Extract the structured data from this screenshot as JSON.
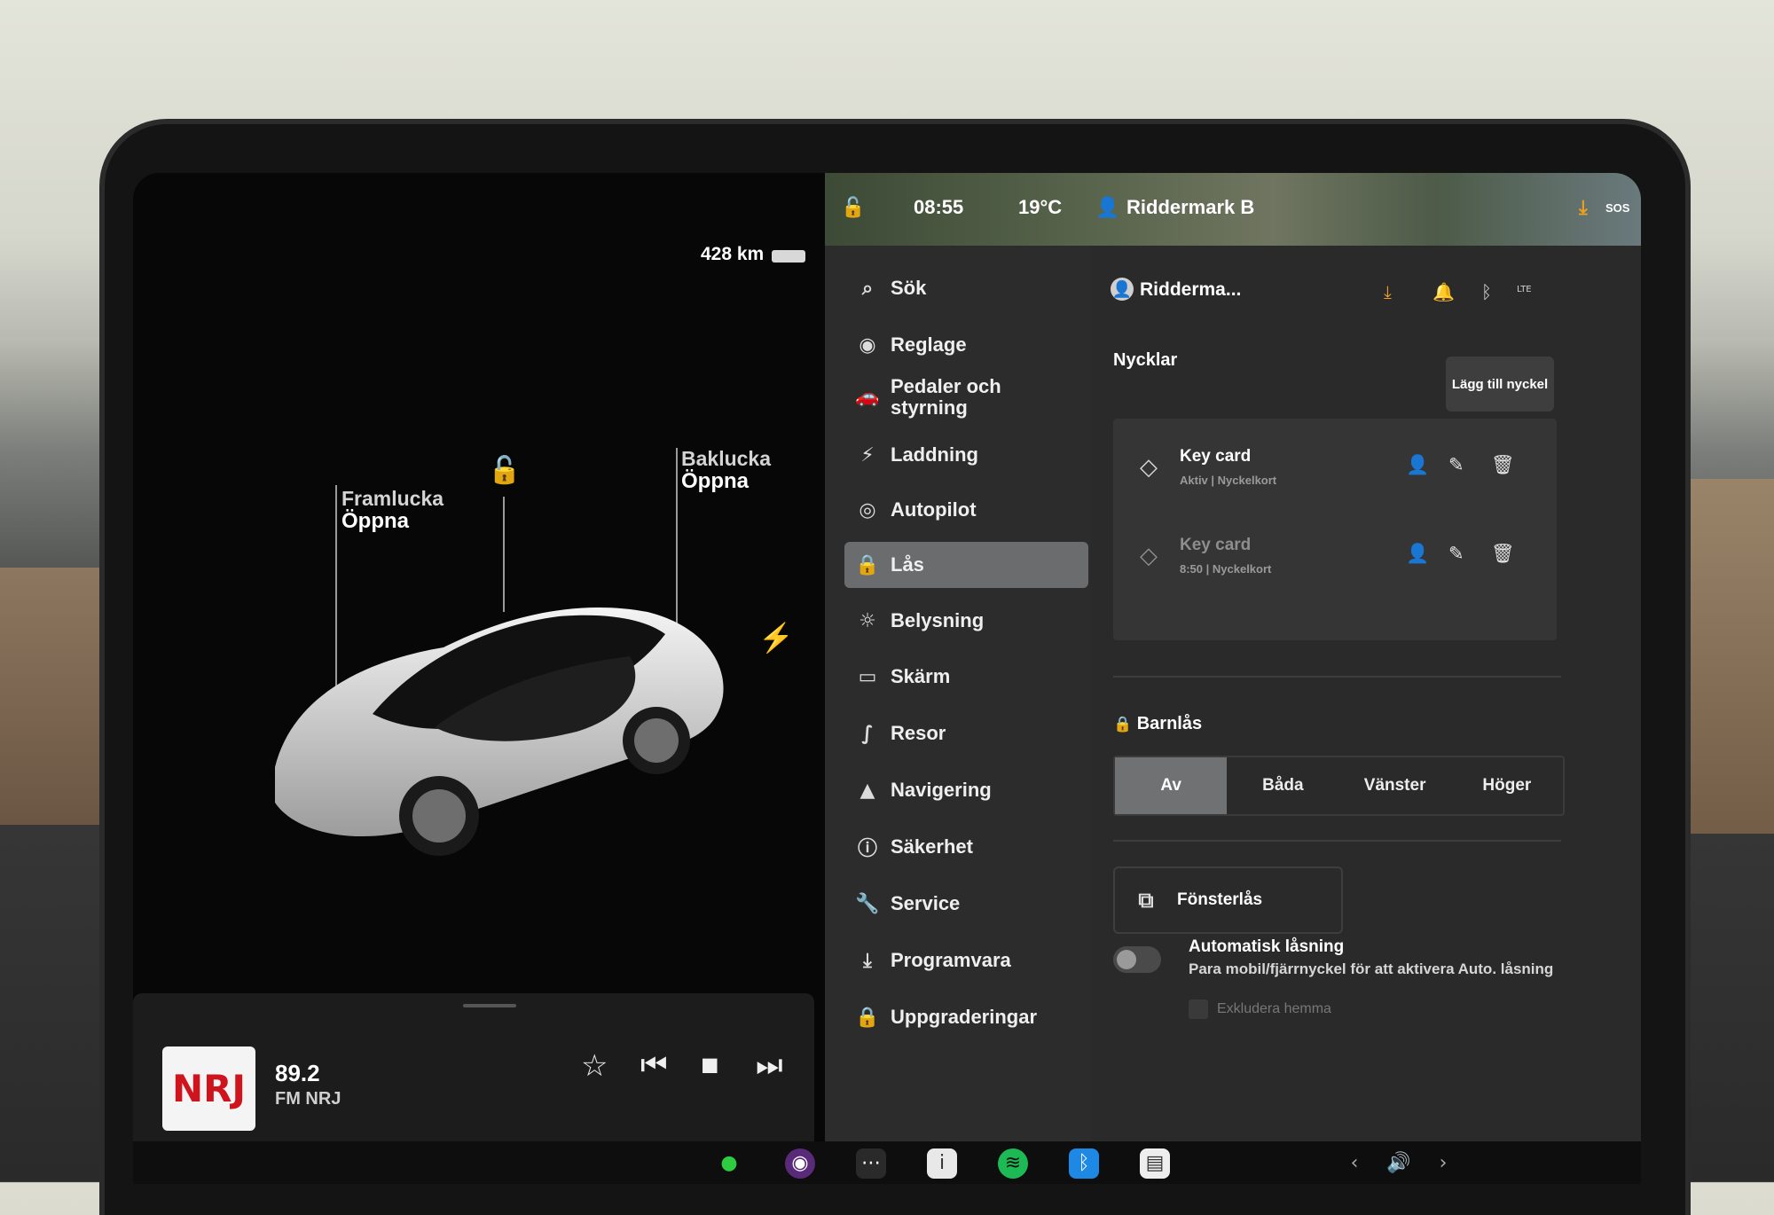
{
  "car": {
    "range": "428 km",
    "front_trunk_label": "Framlucka",
    "front_trunk_action": "Öppna",
    "rear_trunk_label": "Baklucka",
    "rear_trunk_action": "Öppna",
    "lock_icon": "unlock-icon",
    "charge_icon": "charge-port-icon"
  },
  "media": {
    "frequency": "89.2",
    "station": "FM NRJ",
    "logo_text": "NRJ",
    "favorite_icon": "☆",
    "prev_icon": "⏮",
    "stop_icon": "■",
    "next_icon": "⏭"
  },
  "statusbar": {
    "time": "08:55",
    "temperature": "19°C",
    "profile": "Riddermark B",
    "sos": "SOS"
  },
  "nav": {
    "items": [
      {
        "label": "Sök",
        "icon": "⌕"
      },
      {
        "label": "Reglage",
        "icon": "◉"
      },
      {
        "label": "Pedaler och styrning",
        "icon": "🚗"
      },
      {
        "label": "Laddning",
        "icon": "⚡"
      },
      {
        "label": "Autopilot",
        "icon": "◎"
      },
      {
        "label": "Lås",
        "icon": "🔒"
      },
      {
        "label": "Belysning",
        "icon": "☼"
      },
      {
        "label": "Skärm",
        "icon": "▭"
      },
      {
        "label": "Resor",
        "icon": "∫"
      },
      {
        "label": "Navigering",
        "icon": "▲"
      },
      {
        "label": "Säkerhet",
        "icon": "ⓘ"
      },
      {
        "label": "Service",
        "icon": "🔧"
      },
      {
        "label": "Programvara",
        "icon": "⤓"
      },
      {
        "label": "Uppgraderingar",
        "icon": "🔒"
      }
    ],
    "active": "Lås"
  },
  "locks": {
    "profile_name": "Ridderma...",
    "keys_title": "Nycklar",
    "add_key_button": "Lägg till nyckel",
    "keys": [
      {
        "name": "Key card",
        "sub": "Aktiv | Nyckelkort"
      },
      {
        "name": "Key card",
        "sub": "8:50 | Nyckelkort"
      }
    ],
    "child_lock_title": "Barnlås",
    "child_lock_options": [
      "Av",
      "Båda",
      "Vänster",
      "Höger"
    ],
    "child_lock_selected": "Av",
    "window_lock_label": "Fönsterlås",
    "auto_lock_title": "Automatisk låsning",
    "auto_lock_desc": "Para mobil/fjärrnyckel för att aktivera Auto. låsning",
    "auto_lock_enabled": false,
    "exclude_home": "Exkludera hemma",
    "lte_label": "LTE"
  },
  "colors": {
    "accent_download": "#f0a020",
    "active_nav": "#6a6c6e",
    "spotify": "#1db954",
    "bluetooth": "#1e88e5"
  }
}
